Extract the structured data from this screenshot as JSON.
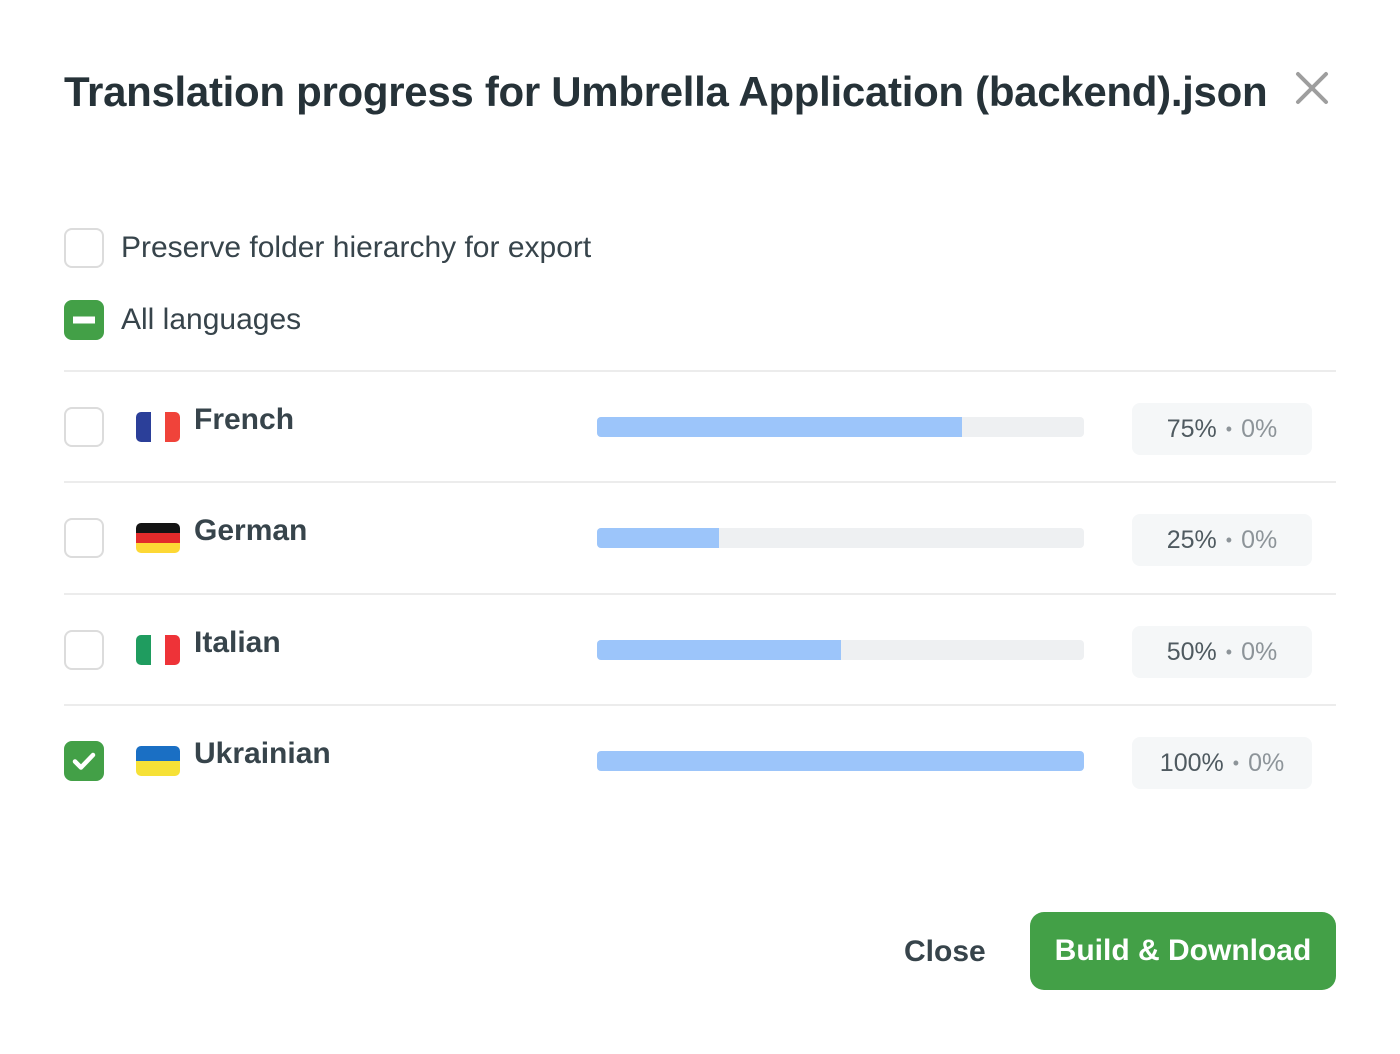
{
  "dialog": {
    "title": "Translation progress for Umbrella Application (backend).json",
    "close_icon": "close-x-icon"
  },
  "options": {
    "preserve_hierarchy": {
      "label": "Preserve folder hierarchy for export",
      "checked": false
    },
    "all_languages": {
      "label": "All languages",
      "state": "indeterminate"
    }
  },
  "languages": [
    {
      "name": "French",
      "flag": "flag-fr-icon",
      "translated": 75,
      "translated_label": "75%",
      "approved_label": "0%",
      "checked": false,
      "flag_colors": [
        "#2b3f99",
        "#ffffff",
        "#f0433a"
      ]
    },
    {
      "name": "German",
      "flag": "flag-de-icon",
      "translated": 25,
      "translated_label": "25%",
      "approved_label": "0%",
      "checked": false,
      "flag_colors": [
        "#141414",
        "#e32b2b",
        "#fdd835"
      ]
    },
    {
      "name": "Italian",
      "flag": "flag-it-icon",
      "translated": 50,
      "translated_label": "50%",
      "approved_label": "0%",
      "checked": false,
      "flag_colors": [
        "#1f9c5f",
        "#ffffff",
        "#ee3338"
      ]
    },
    {
      "name": "Ukrainian",
      "flag": "flag-ua-icon",
      "translated": 100,
      "translated_label": "100%",
      "approved_label": "0%",
      "checked": true,
      "flag_colors": [
        "#1a6fc4",
        "#f6e137"
      ]
    }
  ],
  "stat_separator": "•",
  "footer": {
    "close_label": "Close",
    "build_label": "Build & Download"
  },
  "colors": {
    "accent_green": "#43a047",
    "progress_fill": "#9cc5fa",
    "progress_track": "#eef0f2"
  }
}
